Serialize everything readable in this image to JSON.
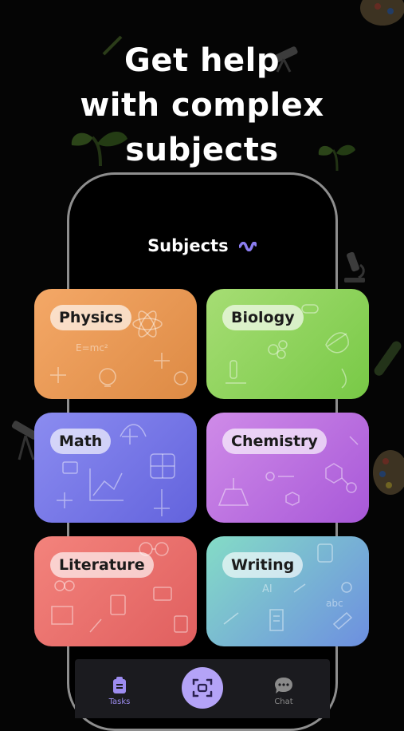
{
  "headline": {
    "line1": "Get help",
    "line2": "with complex",
    "line3": "subjects"
  },
  "screen": {
    "title": "Subjects",
    "subjects": [
      {
        "label": "Physics",
        "color": "#e99a55"
      },
      {
        "label": "Biology",
        "color": "#8fd35d"
      },
      {
        "label": "Math",
        "color": "#7778e6"
      },
      {
        "label": "Chemistry",
        "color": "#bc72e0"
      },
      {
        "label": "Literature",
        "color": "#ea716d"
      },
      {
        "label": "Writing",
        "color": "#79b6d3"
      }
    ]
  },
  "tabbar": {
    "tasks_label": "Tasks",
    "chat_label": "Chat",
    "active_color": "#9d8cf0",
    "scan_button_color": "#b4a3f7"
  }
}
